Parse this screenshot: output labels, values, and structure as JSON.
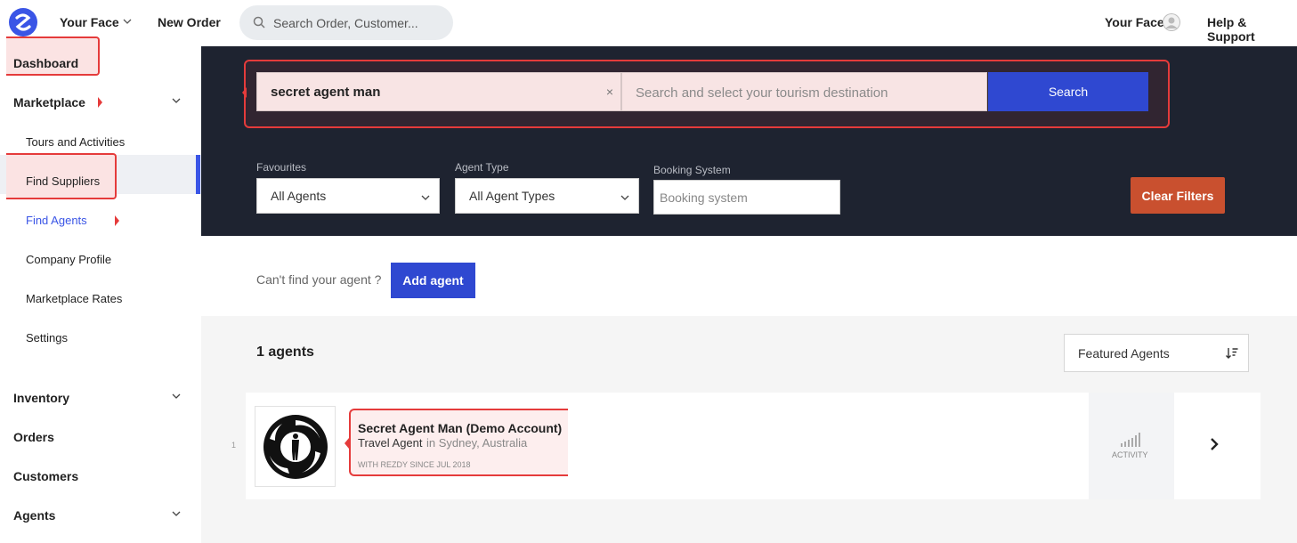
{
  "header": {
    "brand": "Your Face",
    "new_order": "New Order",
    "search_placeholder": "Search Order, Customer...",
    "user_name": "Your Face",
    "help": "Help & Support"
  },
  "sidebar": {
    "dashboard": "Dashboard",
    "marketplace": "Marketplace",
    "sub_items": [
      "Tours and Activities",
      "Find Suppliers",
      "Find Agents",
      "Company Profile",
      "Marketplace Rates",
      "Settings"
    ],
    "inventory": "Inventory",
    "orders": "Orders",
    "customers": "Customers",
    "agents": "Agents",
    "active_item": "Find Agents"
  },
  "search": {
    "keyword_value": "secret agent man",
    "clear_icon": "×",
    "destination_placeholder": "Search and select your tourism destination",
    "button": "Search"
  },
  "filters": {
    "favourites_label": "Favourites",
    "favourites_value": "All Agents",
    "agent_type_label": "Agent Type",
    "agent_type_value": "All Agent Types",
    "booking_label": "Booking System",
    "booking_placeholder": "Booking system",
    "clear_button": "Clear Filters"
  },
  "add": {
    "prompt": "Can't find your agent ?",
    "button": "Add agent"
  },
  "results": {
    "count_text": "1 agents",
    "sort_value": "Featured Agents",
    "rows": [
      {
        "index": "1",
        "name": "Secret Agent Man (Demo Account)",
        "type": "Travel Agent",
        "location": "in Sydney, Australia",
        "since": "WITH REZDY SINCE JUL 2018",
        "activity_label": "ACTIVITY"
      }
    ]
  },
  "colors": {
    "accent": "#2f48d1",
    "dark_panel": "#1e2330",
    "clear_button": "#c9502f",
    "highlight_border": "#e53b3b"
  }
}
